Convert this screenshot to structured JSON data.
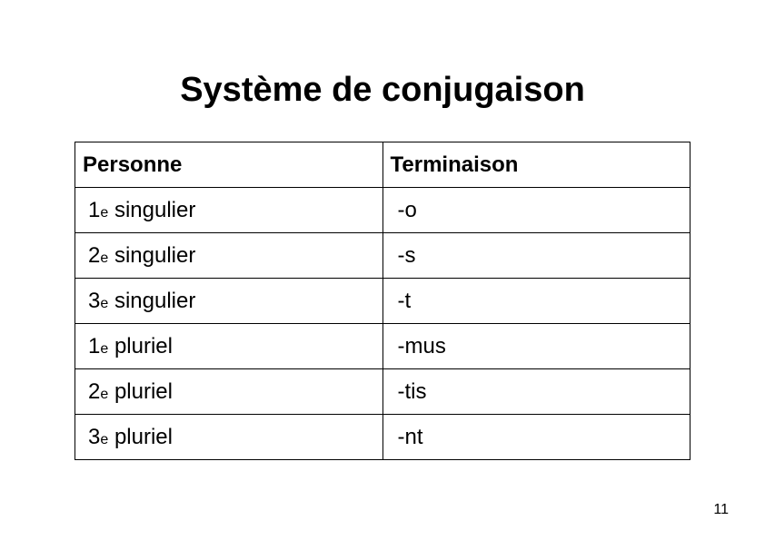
{
  "title": "Système de conjugaison",
  "headers": {
    "col1": "Personne",
    "col2": "Terminaison"
  },
  "rows": [
    {
      "num": "1",
      "ord": "e",
      "form": "singulier",
      "ending": "-o"
    },
    {
      "num": "2",
      "ord": "e",
      "form": "singulier",
      "ending": "-s"
    },
    {
      "num": "3",
      "ord": "e",
      "form": "singulier",
      "ending": "-t"
    },
    {
      "num": "1",
      "ord": "e",
      "form": "pluriel",
      "ending": "-mus"
    },
    {
      "num": "2",
      "ord": "e",
      "form": "pluriel",
      "ending": "-tis"
    },
    {
      "num": "3",
      "ord": "e",
      "form": "pluriel",
      "ending": "-nt"
    }
  ],
  "page_number": "11"
}
